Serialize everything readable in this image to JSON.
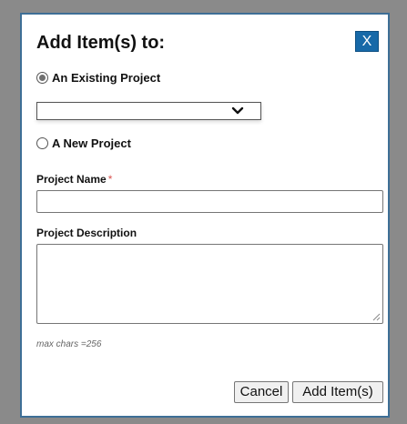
{
  "dialog": {
    "title": "Add Item(s) to:",
    "close_label": "X"
  },
  "options": {
    "existing_label": "An Existing Project",
    "existing_selected": true,
    "new_label": "A New Project",
    "new_selected": false
  },
  "project_select": {
    "selected_value": ""
  },
  "project_name": {
    "label": "Project Name",
    "required_mark": "*",
    "value": ""
  },
  "project_description": {
    "label": "Project Description",
    "value": "",
    "hint": "max chars =256"
  },
  "buttons": {
    "cancel_label": "Cancel",
    "add_label": "Add Item(s)"
  },
  "colors": {
    "close_button_bg": "#1769a8",
    "dialog_border": "#3e6f96",
    "required_mark": "#d9534f"
  }
}
